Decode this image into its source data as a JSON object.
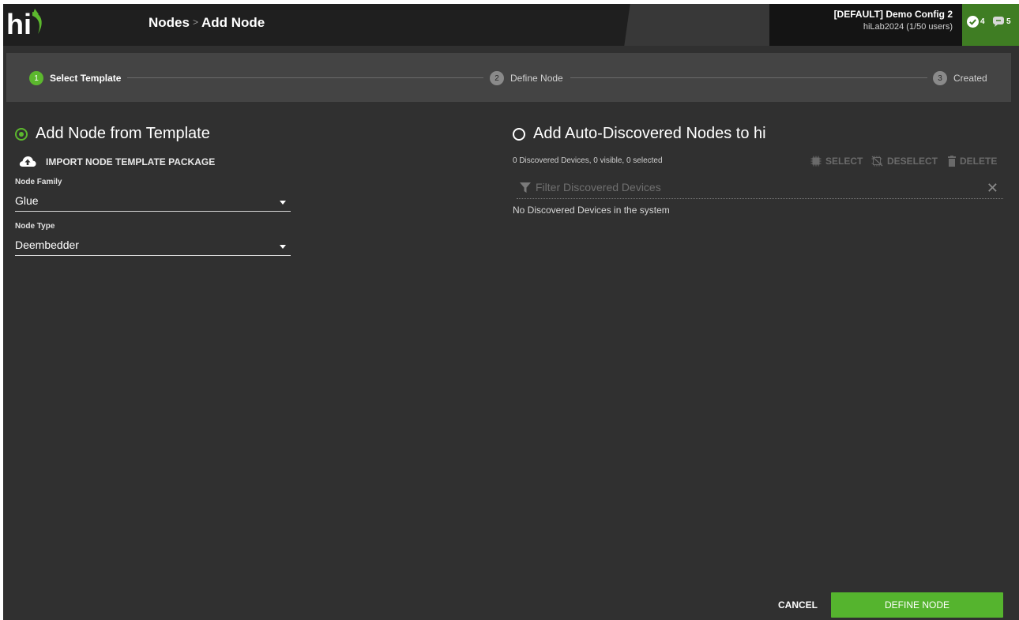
{
  "header": {
    "breadcrumb": [
      "Nodes",
      "Add Node"
    ],
    "separator": ">",
    "config_name": "[DEFAULT] Demo Config 2",
    "user_info": "hiLab2024 (1/50 users)",
    "status_ok_count": "4",
    "status_msg_count": "5"
  },
  "stepper": {
    "steps": [
      {
        "num": "1",
        "label": "Select Template",
        "active": true
      },
      {
        "num": "2",
        "label": "Define Node",
        "active": false
      },
      {
        "num": "3",
        "label": "Created",
        "active": false
      }
    ]
  },
  "left": {
    "title": "Add Node from Template",
    "selected": true,
    "import_label": "IMPORT NODE TEMPLATE PACKAGE",
    "family_label": "Node Family",
    "family_value": "Glue",
    "type_label": "Node Type",
    "type_value": "Deembedder"
  },
  "right": {
    "title": "Add Auto-Discovered Nodes to hi",
    "selected": false,
    "count_text": "0 Discovered Devices, 0 visible, 0 selected",
    "select_label": "SELECT",
    "deselect_label": "DESELECT",
    "delete_label": "DELETE",
    "filter_placeholder": "Filter Discovered Devices",
    "empty_text": "No Discovered Devices in the system"
  },
  "footer": {
    "cancel_label": "CANCEL",
    "define_label": "DEFINE NODE"
  },
  "colors": {
    "accent": "#5cb82e",
    "background": "#303030",
    "header": "#1f1f1f"
  }
}
